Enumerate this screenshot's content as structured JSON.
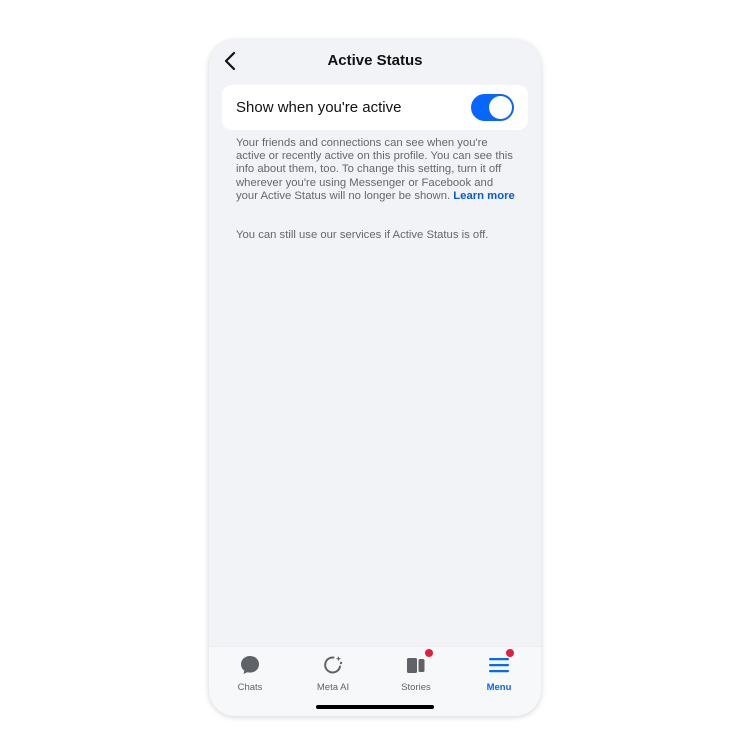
{
  "header": {
    "title": "Active Status",
    "back_icon": "chevron-left-icon"
  },
  "setting": {
    "label": "Show when you're active",
    "toggle_on": true,
    "accent_color": "#0866ff"
  },
  "description": {
    "text": "Your friends and connections can see when you're active or recently active on this profile. You can see this info about them, too. To change this setting, turn it off wherever you're using Messenger or Facebook and your Active Status will no longer be shown. ",
    "link": "Learn more"
  },
  "note": "You can still use our services if Active Status is off.",
  "tabs": [
    {
      "label": "Chats",
      "icon": "chat-bubble-icon",
      "badge": false,
      "active": false
    },
    {
      "label": "Meta AI",
      "icon": "meta-ai-icon",
      "badge": false,
      "active": false
    },
    {
      "label": "Stories",
      "icon": "stories-icon",
      "badge": true,
      "active": false
    },
    {
      "label": "Menu",
      "icon": "menu-icon",
      "badge": true,
      "active": true
    }
  ]
}
